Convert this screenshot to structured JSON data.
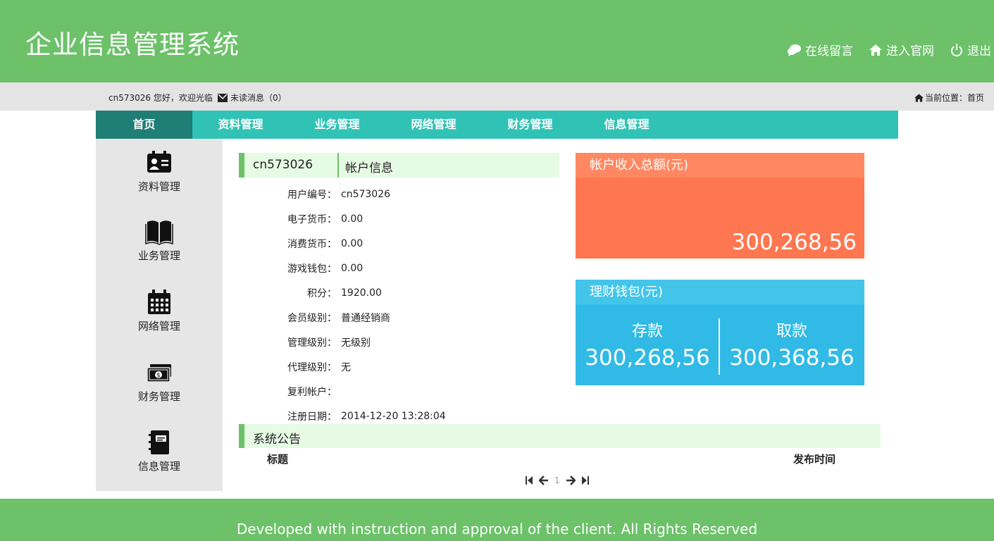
{
  "header": {
    "title": "企业信息管理系统",
    "links": [
      {
        "label": "在线留言",
        "icon": "chat-icon"
      },
      {
        "label": "进入官网",
        "icon": "home-icon"
      },
      {
        "label": "退出",
        "icon": "power-icon"
      }
    ]
  },
  "infobar": {
    "welcome": "cn573026 您好，欢迎光临",
    "messages": "未读消息（0）",
    "position": "当前位置：首页"
  },
  "nav": {
    "items": [
      "首页",
      "资料管理",
      "业务管理",
      "网络管理",
      "财务管理",
      "信息管理"
    ],
    "active": "首页"
  },
  "sidebar": {
    "items": [
      {
        "label": "资料管理",
        "icon": "id-card-icon"
      },
      {
        "label": "业务管理",
        "icon": "book-icon"
      },
      {
        "label": "网络管理",
        "icon": "calendar-icon"
      },
      {
        "label": "财务管理",
        "icon": "money-icon"
      },
      {
        "label": "信息管理",
        "icon": "notebook-icon"
      }
    ]
  },
  "account": {
    "user_id": "cn573026",
    "title": "帐户信息",
    "fields": [
      {
        "label": "用户编号：",
        "value": "cn573026"
      },
      {
        "label": "电子货币：",
        "value": "0.00"
      },
      {
        "label": "消费货币：",
        "value": "0.00"
      },
      {
        "label": "游戏钱包：",
        "value": "0.00"
      },
      {
        "label": "积分：",
        "value": "1920.00"
      },
      {
        "label": "会员级别：",
        "value": "普通经销商"
      },
      {
        "label": "管理级别：",
        "value": "无级别"
      },
      {
        "label": "代理级别：",
        "value": "无"
      },
      {
        "label": "复利帐户：",
        "value": ""
      },
      {
        "label": "注册日期：",
        "value": "2014-12-20 13:28:04"
      }
    ]
  },
  "income_card": {
    "title": "帐户收入总额(元)",
    "value": "300,268,56",
    "color": "#ff7750"
  },
  "wallet_card": {
    "title": "理财钱包(元)",
    "deposit_label": "存款",
    "deposit_value": "300,268,56",
    "withdraw_label": "取款",
    "withdraw_value": "300,368,56",
    "color": "#30bae5"
  },
  "notice": {
    "title": "系统公告",
    "col_title": "标题",
    "col_time": "发布时间",
    "page": "1"
  },
  "footer": {
    "text": "Developed with instruction and approval of the client. All Rights Reserved"
  },
  "colors": {
    "brand_green": "#6cc169",
    "nav_teal": "#30c2b5",
    "nav_active": "#1f7e76"
  }
}
